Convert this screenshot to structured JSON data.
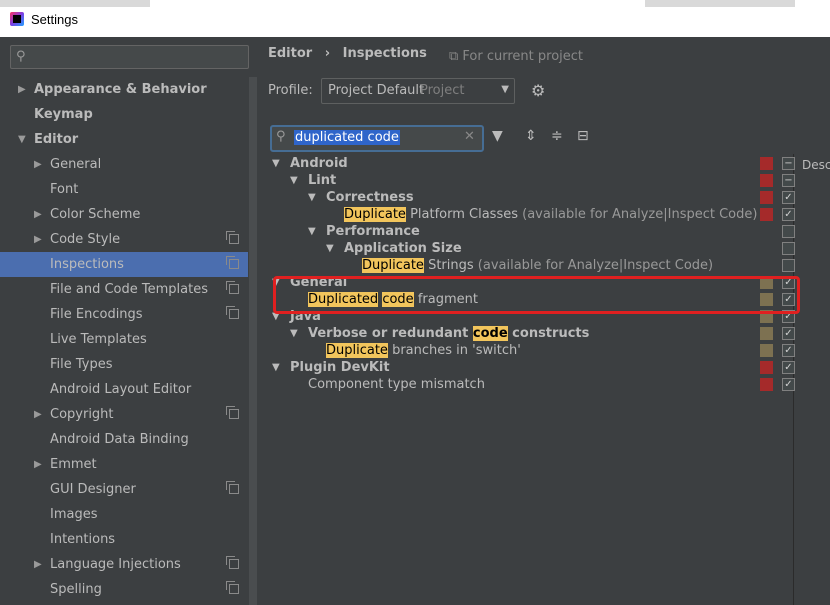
{
  "window": {
    "title": "Settings"
  },
  "left": {
    "search_placeholder": "",
    "items": [
      {
        "label": "Appearance & Behavior",
        "bold": true,
        "arrow": "▶",
        "indent": 0,
        "copy": false
      },
      {
        "label": "Keymap",
        "bold": true,
        "arrow": "",
        "indent": 0,
        "copy": false
      },
      {
        "label": "Editor",
        "bold": true,
        "arrow": "▼",
        "indent": 0,
        "copy": false
      },
      {
        "label": "General",
        "bold": false,
        "arrow": "▶",
        "indent": 1,
        "copy": false
      },
      {
        "label": "Font",
        "bold": false,
        "arrow": "",
        "indent": 1,
        "copy": false
      },
      {
        "label": "Color Scheme",
        "bold": false,
        "arrow": "▶",
        "indent": 1,
        "copy": false
      },
      {
        "label": "Code Style",
        "bold": false,
        "arrow": "▶",
        "indent": 1,
        "copy": true
      },
      {
        "label": "Inspections",
        "bold": false,
        "arrow": "",
        "indent": 1,
        "copy": true,
        "selected": true
      },
      {
        "label": "File and Code Templates",
        "bold": false,
        "arrow": "",
        "indent": 1,
        "copy": true
      },
      {
        "label": "File Encodings",
        "bold": false,
        "arrow": "",
        "indent": 1,
        "copy": true
      },
      {
        "label": "Live Templates",
        "bold": false,
        "arrow": "",
        "indent": 1,
        "copy": false
      },
      {
        "label": "File Types",
        "bold": false,
        "arrow": "",
        "indent": 1,
        "copy": false
      },
      {
        "label": "Android Layout Editor",
        "bold": false,
        "arrow": "",
        "indent": 1,
        "copy": false
      },
      {
        "label": "Copyright",
        "bold": false,
        "arrow": "▶",
        "indent": 1,
        "copy": true
      },
      {
        "label": "Android Data Binding",
        "bold": false,
        "arrow": "",
        "indent": 1,
        "copy": false
      },
      {
        "label": "Emmet",
        "bold": false,
        "arrow": "▶",
        "indent": 1,
        "copy": false
      },
      {
        "label": "GUI Designer",
        "bold": false,
        "arrow": "",
        "indent": 1,
        "copy": true
      },
      {
        "label": "Images",
        "bold": false,
        "arrow": "",
        "indent": 1,
        "copy": false
      },
      {
        "label": "Intentions",
        "bold": false,
        "arrow": "",
        "indent": 1,
        "copy": false
      },
      {
        "label": "Language Injections",
        "bold": false,
        "arrow": "▶",
        "indent": 1,
        "copy": true
      },
      {
        "label": "Spelling",
        "bold": false,
        "arrow": "",
        "indent": 1,
        "copy": true
      }
    ]
  },
  "header": {
    "crumb_editor": "Editor",
    "crumb_sep": "›",
    "crumb_inspections": "Inspections",
    "for_current_project": "For current project",
    "profile_label": "Profile:",
    "profile_value": "Project Default",
    "profile_scope": "Project"
  },
  "filter": {
    "value": "duplicated code"
  },
  "description_label": "Descr",
  "inspections": [
    {
      "indent": 0,
      "arrow": "▼",
      "parts": [
        {
          "t": "Android",
          "s": "b"
        }
      ],
      "sev": "#a52a2a",
      "check": "−"
    },
    {
      "indent": 1,
      "arrow": "▼",
      "parts": [
        {
          "t": "Lint",
          "s": "b"
        }
      ],
      "sev": "#a52a2a",
      "check": "−"
    },
    {
      "indent": 2,
      "arrow": "▼",
      "parts": [
        {
          "t": "Correctness",
          "s": "b"
        }
      ],
      "sev": "#a52a2a",
      "check": "✓"
    },
    {
      "indent": 3,
      "arrow": "",
      "parts": [
        {
          "t": "Duplicate",
          "s": "hl"
        },
        {
          "t": " Platform Classes ",
          "s": ""
        },
        {
          "t": "(available for Analyze|Inspect Code)",
          "s": "gray"
        }
      ],
      "sev": "#a52a2a",
      "check": "✓"
    },
    {
      "indent": 2,
      "arrow": "▼",
      "parts": [
        {
          "t": "Performance",
          "s": "b"
        }
      ],
      "sev": "",
      "check": ""
    },
    {
      "indent": 3,
      "arrow": "▼",
      "parts": [
        {
          "t": "Application Size",
          "s": "b"
        }
      ],
      "sev": "",
      "check": ""
    },
    {
      "indent": 4,
      "arrow": "",
      "parts": [
        {
          "t": "Duplicate",
          "s": "hl"
        },
        {
          "t": " Strings ",
          "s": ""
        },
        {
          "t": "(available for Analyze|Inspect Code)",
          "s": "gray"
        }
      ],
      "sev": "",
      "check": ""
    },
    {
      "indent": 0,
      "arrow": "▼",
      "parts": [
        {
          "t": "General",
          "s": "b"
        }
      ],
      "sev": "#7d7151",
      "check": "✓"
    },
    {
      "indent": 1,
      "arrow": "",
      "parts": [
        {
          "t": "Duplicated",
          "s": "hl"
        },
        {
          "t": " ",
          "s": ""
        },
        {
          "t": "code",
          "s": "hl"
        },
        {
          "t": " fragment",
          "s": ""
        }
      ],
      "sev": "#7d7151",
      "check": "✓"
    },
    {
      "indent": 0,
      "arrow": "▼",
      "parts": [
        {
          "t": "Java",
          "s": "b"
        }
      ],
      "sev": "#7d7151",
      "check": "✓"
    },
    {
      "indent": 1,
      "arrow": "▼",
      "parts": [
        {
          "t": "Verbose or redundant ",
          "s": "b"
        },
        {
          "t": "code",
          "s": "hlb"
        },
        {
          "t": " constructs",
          "s": "b"
        }
      ],
      "sev": "#7d7151",
      "check": "✓"
    },
    {
      "indent": 2,
      "arrow": "",
      "parts": [
        {
          "t": "Duplicate",
          "s": "hl"
        },
        {
          "t": " branches in 'switch'",
          "s": ""
        }
      ],
      "sev": "#7d7151",
      "check": "✓"
    },
    {
      "indent": 0,
      "arrow": "▼",
      "parts": [
        {
          "t": "Plugin DevKit",
          "s": "b"
        }
      ],
      "sev": "#a52a2a",
      "check": "✓"
    },
    {
      "indent": 1,
      "arrow": "",
      "parts": [
        {
          "t": "Component type mismatch",
          "s": ""
        }
      ],
      "sev": "#a52a2a",
      "check": "✓"
    }
  ]
}
